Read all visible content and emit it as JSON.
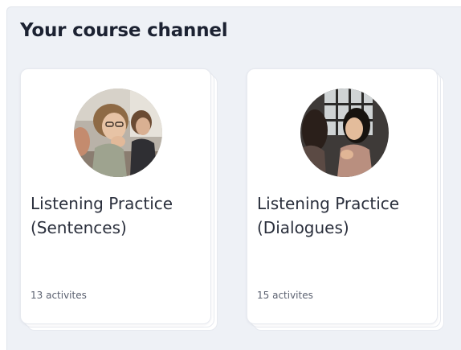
{
  "section": {
    "title": "Your course channel"
  },
  "courses": [
    {
      "title_line1": "Listening Practice",
      "title_line2": "(Sentences)",
      "activities": "13 activites"
    },
    {
      "title_line1": "Listening Practice",
      "title_line2": "(Dialogues)",
      "activities": "15 activites"
    }
  ],
  "colors": {
    "panel_background": "#eef1f6",
    "card_background": "#ffffff",
    "title_text": "#1c2232",
    "body_text": "#2a2f3c",
    "muted_text": "#5b6170"
  },
  "icons": {
    "course_1_thumbnail": "students-listening-photo",
    "course_2_thumbnail": "people-conversing-photo"
  }
}
